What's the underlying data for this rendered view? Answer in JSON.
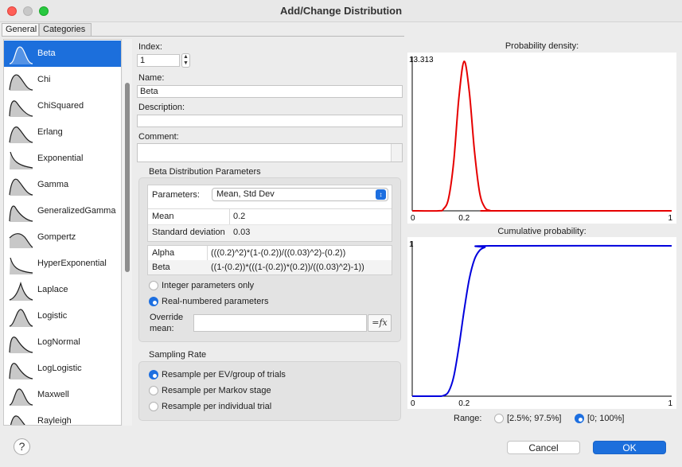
{
  "window": {
    "title": "Add/Change Distribution",
    "tabs": [
      {
        "label": "General"
      },
      {
        "label": "Categories"
      }
    ]
  },
  "distribution_list": {
    "selected_index": 0,
    "items": [
      {
        "label": "Beta",
        "icon": "beta-curve-icon"
      },
      {
        "label": "Chi",
        "icon": "chi-curve-icon"
      },
      {
        "label": "ChiSquared",
        "icon": "chisquared-curve-icon"
      },
      {
        "label": "Erlang",
        "icon": "erlang-curve-icon"
      },
      {
        "label": "Exponential",
        "icon": "exponential-curve-icon"
      },
      {
        "label": "Gamma",
        "icon": "gamma-curve-icon"
      },
      {
        "label": "GeneralizedGamma",
        "icon": "generalizedgamma-curve-icon"
      },
      {
        "label": "Gompertz",
        "icon": "gompertz-curve-icon"
      },
      {
        "label": "HyperExponential",
        "icon": "hyperexponential-curve-icon"
      },
      {
        "label": "Laplace",
        "icon": "laplace-curve-icon"
      },
      {
        "label": "Logistic",
        "icon": "logistic-curve-icon"
      },
      {
        "label": "LogNormal",
        "icon": "lognormal-curve-icon"
      },
      {
        "label": "LogLogistic",
        "icon": "loglogistic-curve-icon"
      },
      {
        "label": "Maxwell",
        "icon": "maxwell-curve-icon"
      },
      {
        "label": "Rayleigh",
        "icon": "rayleigh-curve-icon"
      }
    ]
  },
  "form": {
    "index_label": "Index:",
    "index_value": "1",
    "name_label": "Name:",
    "name_value": "Beta",
    "description_label": "Description:",
    "description_value": "",
    "comment_label": "Comment:",
    "comment_value": ""
  },
  "params_group": {
    "title": "Beta Distribution Parameters",
    "parameters_label": "Parameters:",
    "parameters_selected": "Mean, Std Dev",
    "input_rows": [
      {
        "name": "Mean",
        "value": "0.2"
      },
      {
        "name": "Standard deviation",
        "value": "0.03"
      }
    ],
    "derived_rows": [
      {
        "name": "Alpha",
        "value": "(((0.2)^2)*(1-(0.2))/((0.03)^2)-(0.2))"
      },
      {
        "name": "Beta",
        "value": "((1-(0.2))*(((1-(0.2))*(0.2))/((0.03)^2)-1))"
      }
    ],
    "radio_integer": "Integer parameters only",
    "radio_real": "Real-numbered parameters",
    "real_selected": true,
    "override_label_1": "Override",
    "override_label_2": "mean:",
    "override_value": "",
    "fx_label": "=fx"
  },
  "sampling_group": {
    "title": "Sampling Rate",
    "options": [
      {
        "label": "Resample per EV/group of trials",
        "selected": true
      },
      {
        "label": "Resample per Markov stage",
        "selected": false
      },
      {
        "label": "Resample per individual trial",
        "selected": false
      }
    ]
  },
  "chart_data": [
    {
      "type": "line",
      "title": "Probability density:",
      "x_range": [
        0,
        1
      ],
      "y_max_label": "13.313",
      "y_max": 13.313,
      "x_tick_labels": [
        "0",
        "0.2",
        "1"
      ],
      "series": [
        {
          "color": "#e60000",
          "x": [
            0.0,
            0.1,
            0.12,
            0.14,
            0.16,
            0.18,
            0.2,
            0.22,
            0.24,
            0.26,
            0.28,
            0.3,
            0.32,
            1.0
          ],
          "y": [
            0,
            0,
            0.15,
            1.1,
            4.4,
            10.1,
            13.3,
            10.6,
            5.3,
            1.6,
            0.3,
            0.03,
            0,
            0
          ]
        }
      ]
    },
    {
      "type": "line",
      "title": "Cumulative probability:",
      "x_range": [
        0,
        1
      ],
      "y_max_label": "1",
      "y_max": 1,
      "x_tick_labels": [
        "0",
        "0.2",
        "1"
      ],
      "series": [
        {
          "color": "#0000dd",
          "x": [
            0.0,
            0.1,
            0.12,
            0.14,
            0.16,
            0.18,
            0.2,
            0.22,
            0.24,
            0.26,
            0.28,
            0.3,
            1.0
          ],
          "y": [
            0,
            0,
            0.004,
            0.03,
            0.13,
            0.33,
            0.57,
            0.78,
            0.91,
            0.97,
            0.99,
            1.0,
            1.0
          ]
        }
      ]
    }
  ],
  "range": {
    "label": "Range:",
    "options": [
      {
        "label": "[2.5%; 97.5%]",
        "selected": false
      },
      {
        "label": "[0; 100%]",
        "selected": true
      }
    ]
  },
  "buttons": {
    "cancel": "Cancel",
    "ok": "OK",
    "help": "?"
  },
  "colors": {
    "accent": "#1c6fdc",
    "pdf_line": "#e60000",
    "cdf_line": "#0000dd"
  }
}
